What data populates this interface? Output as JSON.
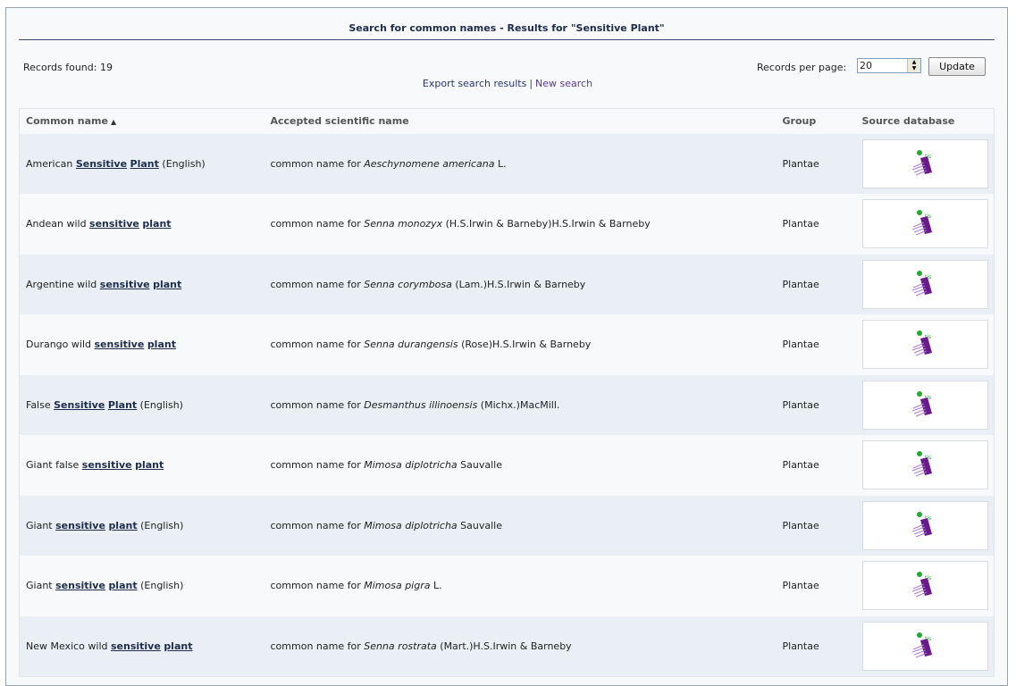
{
  "header": {
    "title": "Search for common names - Results for \"Sensitive Plant\""
  },
  "summary": {
    "records_found": "Records found: 19",
    "records_per_page_label": "Records per page:",
    "records_per_page_value": "20",
    "update_label": "Update"
  },
  "links": {
    "export": "Export search results",
    "separator": "|",
    "new_search": "New search"
  },
  "table": {
    "columns": [
      "Common name",
      "Accepted scientific name",
      "Group",
      "Source database"
    ],
    "rows": [
      {
        "pre": "American ",
        "w1": "Sensitive",
        "w2": "Plant",
        "post": " (English)",
        "sci_prefix": "common name for ",
        "genus_species": "Aeschynomene americana",
        "author": " L.",
        "group": "Plantae",
        "source_icon": "itis-logo-icon"
      },
      {
        "pre": "Andean wild ",
        "w1": "sensitive",
        "w2": "plant",
        "post": "",
        "sci_prefix": "common name for ",
        "genus_species": "Senna monozyx",
        "author": " (H.S.Irwin & Barneby)H.S.Irwin & Barneby",
        "group": "Plantae",
        "source_icon": "itis-logo-icon"
      },
      {
        "pre": "Argentine wild ",
        "w1": "sensitive",
        "w2": "plant",
        "post": "",
        "sci_prefix": "common name for ",
        "genus_species": "Senna corymbosa",
        "author": " (Lam.)H.S.Irwin & Barneby",
        "group": "Plantae",
        "source_icon": "itis-logo-icon"
      },
      {
        "pre": "Durango wild ",
        "w1": "sensitive",
        "w2": "plant",
        "post": "",
        "sci_prefix": "common name for ",
        "genus_species": "Senna durangensis",
        "author": " (Rose)H.S.Irwin & Barneby",
        "group": "Plantae",
        "source_icon": "itis-logo-icon"
      },
      {
        "pre": "False ",
        "w1": "Sensitive",
        "w2": "Plant",
        "post": " (English)",
        "sci_prefix": "common name for ",
        "genus_species": "Desmanthus illinoensis",
        "author": " (Michx.)MacMill.",
        "group": "Plantae",
        "source_icon": "itis-logo-icon"
      },
      {
        "pre": "Giant false ",
        "w1": "sensitive",
        "w2": "plant",
        "post": "",
        "sci_prefix": "common name for ",
        "genus_species": "Mimosa diplotricha",
        "author": " Sauvalle",
        "group": "Plantae",
        "source_icon": "itis-logo-icon"
      },
      {
        "pre": "Giant ",
        "w1": "sensitive",
        "w2": "plant",
        "post": " (English)",
        "sci_prefix": "common name for ",
        "genus_species": "Mimosa diplotricha",
        "author": " Sauvalle",
        "group": "Plantae",
        "source_icon": "itis-logo-icon"
      },
      {
        "pre": "Giant ",
        "w1": "sensitive",
        "w2": "plant",
        "post": " (English)",
        "sci_prefix": "common name for ",
        "genus_species": "Mimosa pigra",
        "author": " L.",
        "group": "Plantae",
        "source_icon": "itis-logo-icon"
      },
      {
        "pre": "New Mexico wild ",
        "w1": "sensitive",
        "w2": "plant",
        "post": "",
        "sci_prefix": "common name for ",
        "genus_species": "Senna rostrata",
        "author": " (Mart.)H.S.Irwin & Barneby",
        "group": "Plantae",
        "source_icon": "itis-logo-icon"
      }
    ]
  },
  "colors": {
    "accent": "#1e2c4c",
    "row_alt": "#e9eff4",
    "logo_purple": "#6a1b8a",
    "logo_green": "#22aa33"
  }
}
